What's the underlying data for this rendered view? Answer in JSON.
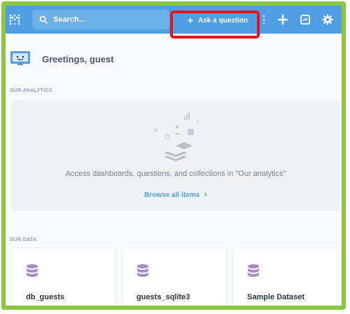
{
  "nav": {
    "search_placeholder": "Search...",
    "ask_label": "Ask a question",
    "ask_icon": "+"
  },
  "greeting": "Greetings, guest",
  "our_analytics": {
    "label": "OUR ANALYTICS",
    "empty_message": "Access dashboards, questions, and collections in \"Our analytics\"",
    "browse_link": "Browse all items",
    "browse_arrow": "›"
  },
  "our_data": {
    "label": "OUR DATA",
    "databases": [
      {
        "name": "db_guests"
      },
      {
        "name": "guests_sqlite3"
      },
      {
        "name": "Sample Dataset"
      }
    ]
  },
  "colors": {
    "nav_bg": "#509ee3",
    "frame_border": "#8ac640",
    "highlight": "#e8131a",
    "db_icon": "#a989c5"
  }
}
